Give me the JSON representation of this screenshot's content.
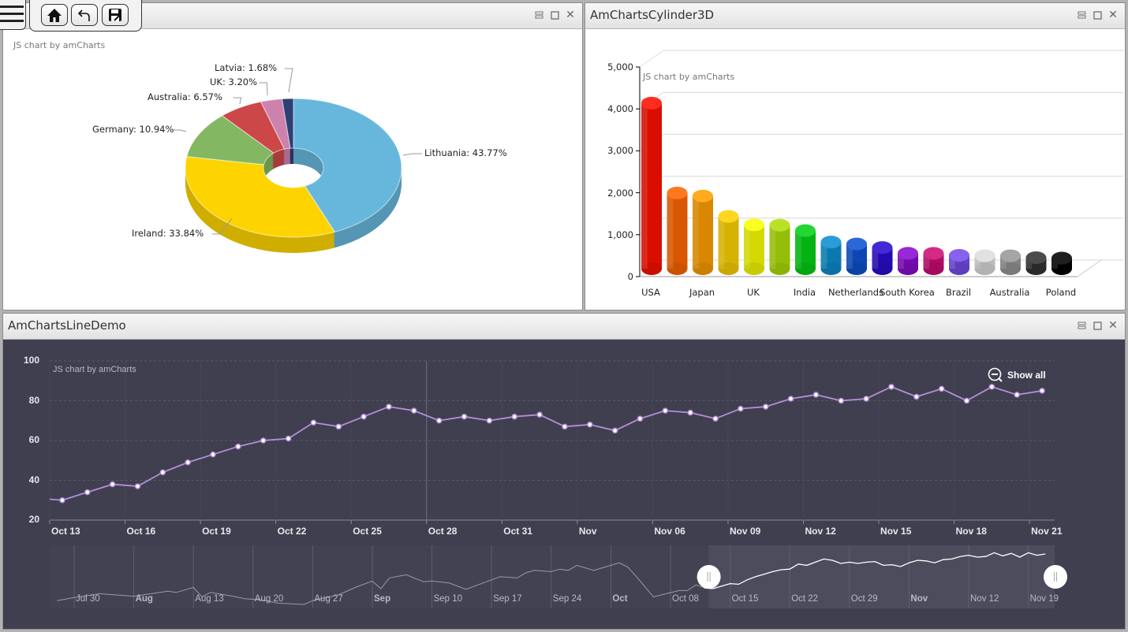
{
  "toolbar": {
    "menu_icon": "hamburger-icon",
    "home_icon": "home-icon",
    "undo_icon": "undo-icon",
    "save_icon": "save-icon"
  },
  "panels": {
    "pie": {
      "title": "",
      "credit": "JS chart by amCharts"
    },
    "cylinder": {
      "title": "AmChartsCylinder3D",
      "credit": "JS chart by amCharts"
    },
    "line": {
      "title": "AmChartsLineDemo",
      "credit": "JS chart by amCharts",
      "show_all": "Show all"
    }
  },
  "window_buttons": {
    "restore": "restore-icon",
    "maximize": "maximize-icon",
    "close": "close-icon",
    "close_glyph": "✕"
  },
  "chart_data": [
    {
      "type": "pie",
      "style": "3d-donut",
      "categories": [
        "Lithuania",
        "Ireland",
        "Germany",
        "Australia",
        "UK",
        "Latvia"
      ],
      "values": [
        43.77,
        33.84,
        10.94,
        6.57,
        3.2,
        1.68
      ],
      "labels": [
        "Lithuania: 43.77%",
        "Ireland: 33.84%",
        "Germany: 10.94%",
        "Australia: 6.57%",
        "UK: 3.20%",
        "Latvia: 1.68%"
      ],
      "colors": [
        "#67b7dc",
        "#fdd400",
        "#84b761",
        "#cc4748",
        "#cd82ad",
        "#2f4074"
      ]
    },
    {
      "type": "bar",
      "style": "3d-cylinder",
      "tick_labels": [
        "USA",
        "",
        "Japan",
        "",
        "UK",
        "",
        "India",
        "",
        "Netherlands",
        "",
        "South Korea",
        "",
        "Brazil",
        "",
        "Australia",
        "",
        "Poland"
      ],
      "values": [
        4025,
        1882,
        1809,
        1322,
        1122,
        1114,
        984,
        711,
        665,
        580,
        443,
        441,
        395,
        386,
        384,
        338,
        328
      ],
      "colors": [
        "#FF0F00",
        "#FF6600",
        "#FF9E01",
        "#FCD202",
        "#F8FF01",
        "#B0DE09",
        "#04D215",
        "#0D8ECF",
        "#0D52D1",
        "#2A0CD0",
        "#8A0CCF",
        "#CD0D74",
        "#754DEB",
        "#DDDDDD",
        "#999999",
        "#333333",
        "#000000"
      ],
      "ylim": [
        0,
        5000
      ],
      "yticks": [
        "0",
        "1,000",
        "2,000",
        "3,000",
        "4,000",
        "5,000"
      ],
      "grid": true
    },
    {
      "type": "line",
      "ylim": [
        20,
        100
      ],
      "yticks": [
        "20",
        "40",
        "60",
        "80",
        "100"
      ],
      "x": [
        "Oct 12",
        "Oct 13",
        "Oct 14",
        "Oct 15",
        "Oct 16",
        "Oct 17",
        "Oct 18",
        "Oct 19",
        "Oct 20",
        "Oct 21",
        "Oct 22",
        "Oct 23",
        "Oct 24",
        "Oct 25",
        "Oct 26",
        "Oct 27",
        "Oct 28",
        "Oct 29",
        "Oct 30",
        "Oct 31",
        "Nov 1",
        "Nov 2",
        "Nov 3",
        "Nov 4",
        "Nov 5",
        "Nov 6",
        "Nov 7",
        "Nov 8",
        "Nov 9",
        "Nov 10",
        "Nov 11",
        "Nov 12",
        "Nov 13",
        "Nov 14",
        "Nov 15",
        "Nov 16",
        "Nov 17",
        "Nov 18",
        "Nov 19",
        "Nov 20",
        "Nov 21"
      ],
      "values": [
        31,
        30,
        34,
        38,
        37,
        44,
        49,
        53,
        57,
        60,
        61,
        69,
        67,
        72,
        77,
        75,
        70,
        72,
        70,
        72,
        73,
        67,
        68,
        65,
        71,
        75,
        74,
        71,
        76,
        77,
        81,
        83,
        80,
        81,
        87,
        82,
        86,
        80,
        87,
        83,
        85
      ],
      "xticks": [
        {
          "date": "Oct 13",
          "label": "Oct 13"
        },
        {
          "date": "Oct 16",
          "label": "Oct 16"
        },
        {
          "date": "Oct 19",
          "label": "Oct 19"
        },
        {
          "date": "Oct 22",
          "label": "Oct 22"
        },
        {
          "date": "Oct 25",
          "label": "Oct 25"
        },
        {
          "date": "Oct 28",
          "label": "Oct 28"
        },
        {
          "date": "Oct 31",
          "label": "Oct 31"
        },
        {
          "date": "Nov 3",
          "label": "Nov",
          "bold": true
        },
        {
          "date": "Nov 6",
          "label": "Nov 06"
        },
        {
          "date": "Nov 9",
          "label": "Nov 09"
        },
        {
          "date": "Nov 12",
          "label": "Nov 12"
        },
        {
          "date": "Nov 15",
          "label": "Nov 15"
        },
        {
          "date": "Nov 18",
          "label": "Nov 18"
        },
        {
          "date": "Nov 21",
          "label": "Nov 21"
        }
      ],
      "line_color": "#b48fd9",
      "background": "#403f4f",
      "cursor_date": "Oct 28",
      "grid": true,
      "scrollbar": {
        "selected_range": [
          "Oct 13",
          "Nov 21"
        ],
        "ticks": [
          {
            "date": "Jul 30",
            "label": "Jul 30"
          },
          {
            "date": "Aug 6",
            "label": "Aug",
            "bold": true
          },
          {
            "date": "Aug 13",
            "label": "Aug 13"
          },
          {
            "date": "Aug 20",
            "label": "Aug 20"
          },
          {
            "date": "Aug 27",
            "label": "Aug 27"
          },
          {
            "date": "Sep 3",
            "label": "Sep",
            "bold": true
          },
          {
            "date": "Sep 10",
            "label": "Sep 10"
          },
          {
            "date": "Sep 17",
            "label": "Sep 17"
          },
          {
            "date": "Sep 24",
            "label": "Sep 24"
          },
          {
            "date": "Oct 1",
            "label": "Oct",
            "bold": true
          },
          {
            "date": "Oct 8",
            "label": "Oct 08"
          },
          {
            "date": "Oct 15",
            "label": "Oct 15"
          },
          {
            "date": "Oct 22",
            "label": "Oct 22"
          },
          {
            "date": "Oct 29",
            "label": "Oct 29"
          },
          {
            "date": "Nov 5",
            "label": "Nov",
            "bold": true
          },
          {
            "date": "Nov 12",
            "label": "Nov 12"
          },
          {
            "date": "Nov 19",
            "label": "Nov 19"
          }
        ],
        "earlier_x": [
          "Jul 28",
          "Jul 30",
          "Aug 2",
          "Aug 6",
          "Aug 10",
          "Aug 11",
          "Aug 13",
          "Aug 14",
          "Aug 15",
          "Aug 18",
          "Aug 19",
          "Aug 21",
          "Aug 23",
          "Aug 26",
          "Aug 27",
          "Aug 30",
          "Sep 1",
          "Sep 3",
          "Sep 4",
          "Sep 5",
          "Sep 7",
          "Sep 9",
          "Sep 10",
          "Sep 12",
          "Sep 14",
          "Sep 16",
          "Sep 18",
          "Sep 20",
          "Sep 21",
          "Sep 22",
          "Sep 24",
          "Sep 25",
          "Sep 26",
          "Sep 27",
          "Sep 29",
          "Oct 2",
          "Oct 3",
          "Oct 4",
          "Oct 6",
          "Oct 9",
          "Oct 10",
          "Oct 11"
        ],
        "earlier_values": [
          11,
          16,
          22,
          18,
          26,
          24,
          32,
          17,
          24,
          17,
          14,
          12,
          7,
          5,
          11,
          20,
          32,
          42,
          30,
          47,
          52,
          41,
          42,
          39,
          29,
          39,
          49,
          47,
          55,
          59,
          57,
          61,
          59,
          67,
          59,
          71,
          64,
          49,
          17,
          27,
          27,
          36
        ]
      }
    }
  ]
}
